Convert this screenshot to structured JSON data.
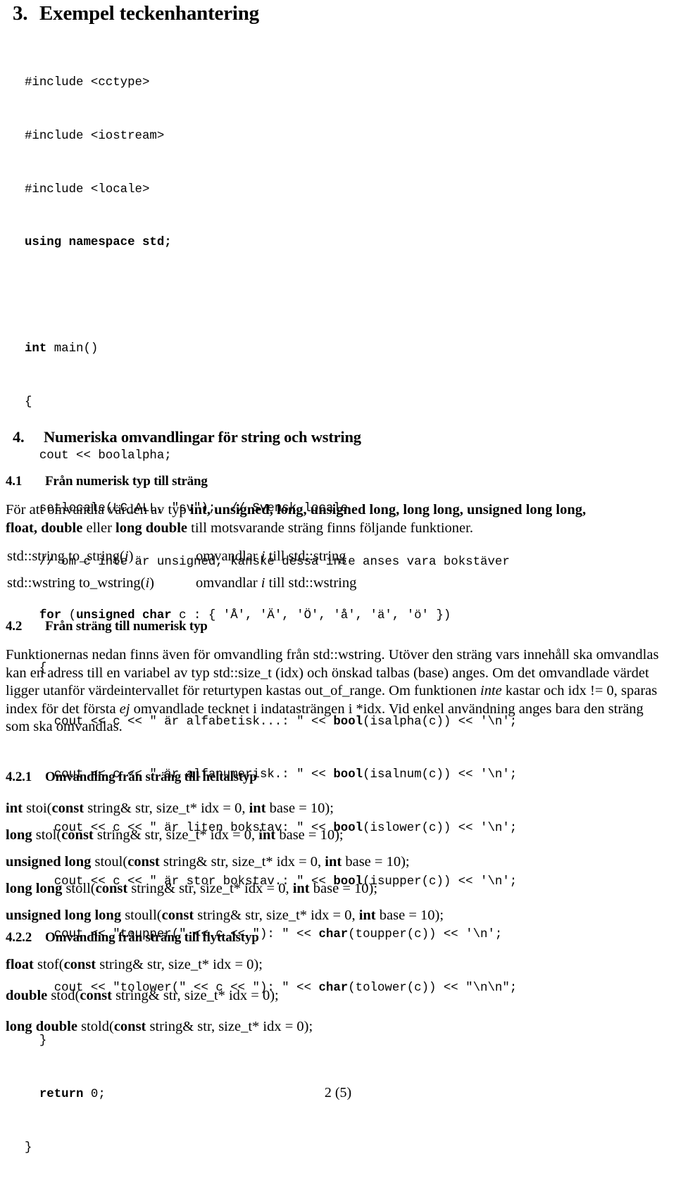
{
  "document": {
    "footer": "2 (5)"
  },
  "section3": {
    "number": "3.",
    "title": "Exempel teckenhantering",
    "code_lines": [
      "#include <cctype>",
      "#include <iostream>",
      "#include <locale>",
      "using namespace std;",
      "",
      "int main()",
      "{",
      "  cout << boolalpha;",
      "  setlocale(LC_ALL, \"sv\");  // Svensk locale",
      "  // om c inte är unsigned, kanske dessa inte anses vara bokstäver",
      "  for (unsigned char c : { 'Å', 'Ä', 'Ö', 'å', 'ä', 'ö' })",
      "  {",
      "    cout << c << \" är alfabetisk...: \" << bool(isalpha(c)) << '\\n';",
      "    cout << c << \" är alfanumerisk.: \" << bool(isalnum(c)) << '\\n';",
      "    cout << c << \" är liten bokstav: \" << bool(islower(c)) << '\\n';",
      "    cout << c << \" är stor bokstav.: \" << bool(isupper(c)) << '\\n';",
      "    cout << \"toupper(\" << c << \"): \" << char(toupper(c)) << '\\n';",
      "    cout << \"tolower(\" << c << \"): \" << char(tolower(c)) << \"\\n\\n\";",
      "  }",
      "  return 0;",
      "}"
    ]
  },
  "section4": {
    "number": "4.",
    "title": "Numeriska omvandlingar för string och wstring"
  },
  "section41": {
    "number": "4.1",
    "title": "Från numerisk typ till sträng",
    "paragraph_prefix": "För att omvandla värden av typ ",
    "paragraph_types_1": "int, unsigned, long, unsigned long, long long, unsigned long long,",
    "paragraph_types_2a": "float, double",
    "paragraph_mid": " eller ",
    "paragraph_types_2b": "long double",
    "paragraph_suffix": " till motsvarande sträng finns  följande funktioner.",
    "table": [
      {
        "signature_a": "std::string to_string(",
        "signature_i": "i",
        "signature_b": ")",
        "desc_a": "omvandlar ",
        "desc_i": "i",
        "desc_b": " till std::string"
      },
      {
        "signature_a": "std::wstring to_wstring(",
        "signature_i": "i",
        "signature_b": ")",
        "desc_a": "omvandlar ",
        "desc_i": "i",
        "desc_b": " till std::wstring"
      }
    ]
  },
  "section42": {
    "number": "4.2",
    "title": "Från sträng till numerisk typ",
    "para_1": "Funktionernas nedan finns även för omvandling från std::wstring. Utöver den sträng vars innehåll ska omvandlas kan en adress till en variabel av typ std::size_t (idx) och önskad talbas (base) anges. Om det omvandlade värdet ligger utanför värdeintervallet för returtypen kastas out_of_range. Om funktionen ",
    "para_em_1": "inte",
    "para_2": " kastar och idx != 0, sparas index för det första ",
    "para_em_2": "ej",
    "para_3": " omvandlade tecknet i indatasträngen i *idx. Vid enkel användning anges bara den sträng som ska omvandlas."
  },
  "section421": {
    "number": "4.2.1",
    "title": "Omvandling från sträng till heltalstyp",
    "signatures": [
      {
        "ret": "int",
        "name": " stoi(",
        "kw1": "const",
        "mid": " string& str, size_t* idx = 0, ",
        "kw2": "int",
        "tail": " base = 10);"
      },
      {
        "ret": "long",
        "name": " stol(",
        "kw1": "const",
        "mid": " string& str, size_t* idx = 0, ",
        "kw2": "int",
        "tail": " base = 10);"
      },
      {
        "ret": "unsigned long",
        "name": " stoul(",
        "kw1": "const",
        "mid": " string& str, size_t* idx = 0, ",
        "kw2": "int",
        "tail": " base = 10);"
      },
      {
        "ret": "long long",
        "name": " stoll(",
        "kw1": "const",
        "mid": " string& str, size_t* idx = 0, ",
        "kw2": "int",
        "tail": " base = 10);"
      },
      {
        "ret": "unsigned long long",
        "name": " stoull(",
        "kw1": "const",
        "mid": " string& str, size_t* idx = 0, ",
        "kw2": "int",
        "tail": " base = 10);"
      }
    ]
  },
  "section422": {
    "number": "4.2.2",
    "title": "Omvandling från sträng till flyttalstyp",
    "signatures": [
      {
        "ret": "float",
        "name": " stof(",
        "kw1": "const",
        "mid": " string& str, size_t* idx = 0);",
        "kw2": "",
        "tail": ""
      },
      {
        "ret": "double",
        "name": " stod(",
        "kw1": "const",
        "mid": " string& str, size_t* idx = 0);",
        "kw2": "",
        "tail": ""
      },
      {
        "ret": "long double",
        "name": " stold(",
        "kw1": "const",
        "mid": " string& str, size_t* idx = 0);",
        "kw2": "",
        "tail": ""
      }
    ]
  }
}
